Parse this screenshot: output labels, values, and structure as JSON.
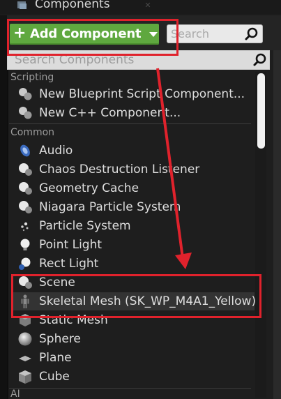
{
  "panel": {
    "title": "Components",
    "close_glyph": "✕"
  },
  "toolbar": {
    "add_component_plus": "+",
    "add_component_label": "Add Component",
    "search_placeholder": "Search"
  },
  "dropdown": {
    "search_placeholder": "Search Components",
    "sections": {
      "scripting": {
        "header": "Scripting",
        "items": [
          {
            "label": "New Blueprint Script Component...",
            "icon": "blueprint-script-icon"
          },
          {
            "label": "New C++ Component...",
            "icon": "cpp-component-icon"
          }
        ]
      },
      "common": {
        "header": "Common",
        "items": [
          {
            "label": "Audio",
            "icon": "audio-icon"
          },
          {
            "label": "Chaos Destruction Listener",
            "icon": "chaos-listener-icon"
          },
          {
            "label": "Geometry Cache",
            "icon": "geometry-cache-icon"
          },
          {
            "label": "Niagara Particle System",
            "icon": "niagara-icon"
          },
          {
            "label": "Particle System",
            "icon": "particle-system-icon"
          },
          {
            "label": "Point Light",
            "icon": "point-light-icon"
          },
          {
            "label": "Rect Light",
            "icon": "rect-light-icon"
          },
          {
            "label": "Scene",
            "icon": "scene-icon"
          },
          {
            "label": "Skeletal Mesh  (SK_WP_M4A1_Yellow)",
            "icon": "skeletal-mesh-icon"
          },
          {
            "label": "Static Mesh",
            "icon": "static-mesh-icon"
          },
          {
            "label": "Sphere",
            "icon": "sphere-icon"
          },
          {
            "label": "Plane",
            "icon": "plane-icon"
          },
          {
            "label": "Cube",
            "icon": "cube-icon"
          }
        ]
      },
      "ai": {
        "header": "AI"
      }
    }
  },
  "colors": {
    "accent_green": "#5fa83f",
    "annotation_red": "#e0222c",
    "background": "#1e1e1e",
    "text": "#dedede",
    "section_text": "#9b9b9b"
  }
}
